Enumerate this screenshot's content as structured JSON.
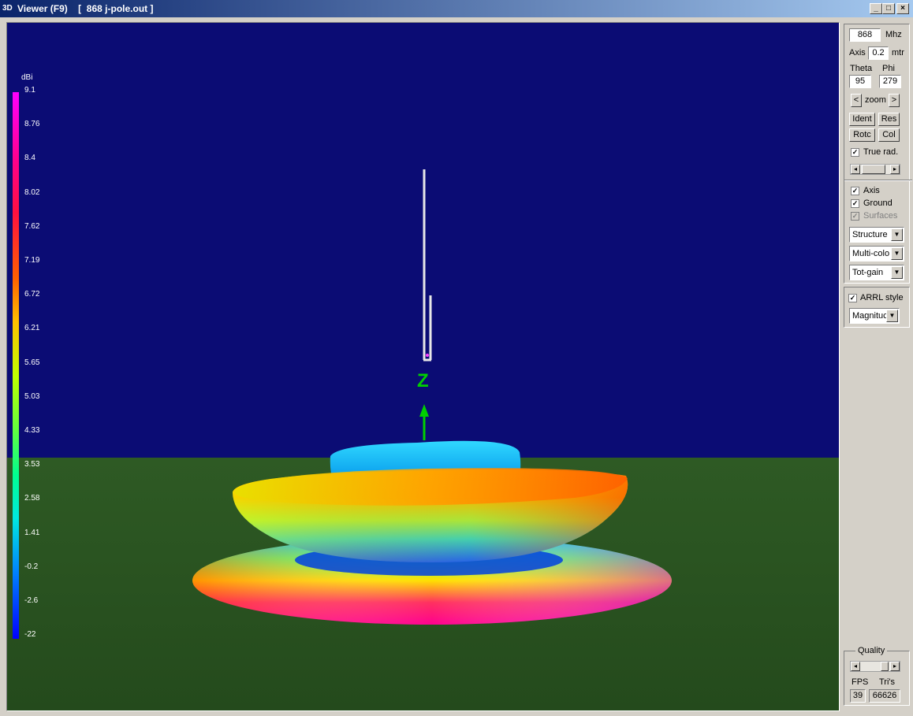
{
  "window": {
    "icon_text": "3D",
    "title": "Viewer (F9)    [  868 j-pole.out ]",
    "minimize_label": "_",
    "maximize_label": "□",
    "close_label": "×"
  },
  "legend": {
    "unit": "dBi",
    "ticks": [
      "9.1",
      "8.76",
      "8.4",
      "8.02",
      "7.62",
      "7.19",
      "6.72",
      "6.21",
      "5.65",
      "5.03",
      "4.33",
      "3.53",
      "2.58",
      "1.41",
      "-0.2",
      "-2.6",
      "-22"
    ]
  },
  "viewport": {
    "axis_label": "Z",
    "colors": {
      "sky": "#0b0c74",
      "ground": "#2e5a24",
      "axis": "#00d000"
    }
  },
  "panel": {
    "frequency": {
      "value": "868",
      "unit": "Mhz"
    },
    "axis": {
      "label": "Axis",
      "value": "0.2",
      "unit": "mtr"
    },
    "theta": {
      "label": "Theta",
      "value": "95"
    },
    "phi": {
      "label": "Phi",
      "value": "279"
    },
    "zoom": {
      "left": "<",
      "label": "zoom",
      "right": ">"
    },
    "buttons": {
      "ident": "Ident",
      "res": "Res",
      "rotc": "Rotc",
      "col": "Col"
    },
    "true_rad": {
      "label": "True rad.",
      "checked": true
    },
    "checks": {
      "axis": {
        "label": "Axis",
        "checked": true
      },
      "ground": {
        "label": "Ground",
        "checked": true
      },
      "surfaces": {
        "label": "Surfaces",
        "checked": true,
        "disabled": true
      }
    },
    "dropdowns": {
      "structure": "Structure",
      "color": "Multi-colo",
      "gain": "Tot-gain"
    },
    "arrl": {
      "label": "ARRL style",
      "checked": true,
      "mode": "Magnituc"
    },
    "quality": {
      "label": "Quality"
    },
    "stats": {
      "fps_label": "FPS",
      "fps": "39",
      "tris_label": "Tri's",
      "tris": "66626"
    }
  }
}
